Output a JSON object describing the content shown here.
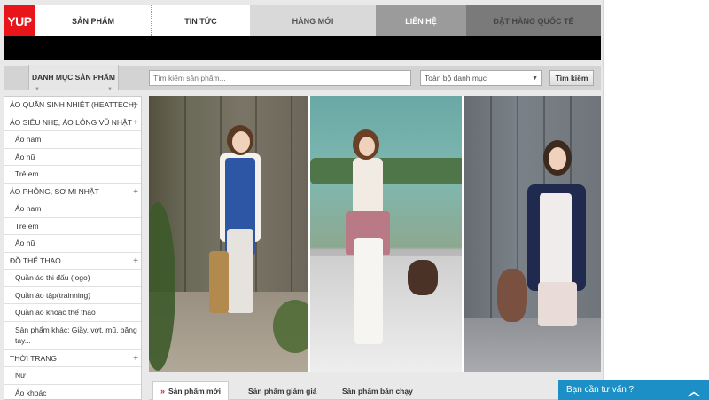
{
  "logo": "YUP",
  "nav": [
    "SẢN PHẨM",
    "TIN TỨC",
    "HÀNG MỚI",
    "LIÊN HỆ",
    "ĐẶT HÀNG QUỐC TẾ"
  ],
  "search": {
    "category_tab": "DANH MỤC SẢN PHẨM",
    "placeholder": "Tìm kiếm sản phẩm...",
    "select_value": "Toàn bộ danh mục",
    "button": "Tìm kiếm"
  },
  "sidebar": [
    {
      "label": "ÁO QUẦN SINH NHIỆT (HEATTECH)",
      "type": "cat",
      "plus": "+"
    },
    {
      "label": "ÁO SIÊU NHẸ, ÁO LÔNG VŨ NHẬT",
      "type": "cat",
      "plus": "+"
    },
    {
      "label": "Áo nam",
      "type": "sub"
    },
    {
      "label": "Áo nữ",
      "type": "sub"
    },
    {
      "label": "Trẻ em",
      "type": "sub"
    },
    {
      "label": "ÁO PHÔNG, SƠ MI NHẬT",
      "type": "cat",
      "plus": "+"
    },
    {
      "label": "Áo nam",
      "type": "sub"
    },
    {
      "label": "Trẻ em",
      "type": "sub"
    },
    {
      "label": "Áo nữ",
      "type": "sub"
    },
    {
      "label": "ĐỒ THỂ THAO",
      "type": "cat",
      "plus": "+"
    },
    {
      "label": "Quần áo thi đấu (logo)",
      "type": "sub"
    },
    {
      "label": "Quần áo tập(trainning)",
      "type": "sub"
    },
    {
      "label": "Quần áo khoác thể thao",
      "type": "sub"
    },
    {
      "label": "Sản phẩm khác: Giầy, vợt, mũ, băng tay...",
      "type": "sub",
      "tall": true
    },
    {
      "label": "THỜI TRANG",
      "type": "cat",
      "plus": "+"
    },
    {
      "label": "Nữ",
      "type": "sub"
    },
    {
      "label": "Áo khoác",
      "type": "sub"
    }
  ],
  "tabs": [
    "Sản phẩm mới",
    "Sản phẩm giảm giá",
    "Sản phẩm bán chạy"
  ],
  "chat": {
    "label": "Bạn cần tư vấn ?",
    "arrow": "︿"
  },
  "icons": {
    "tab_chevron": "»"
  },
  "colors": {
    "brand_red": "#e8151b",
    "chat_blue": "#1c8fc6",
    "active_chevron": "#d3202b"
  }
}
